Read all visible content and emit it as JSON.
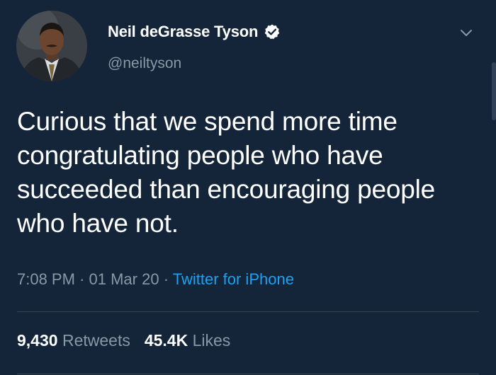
{
  "author": {
    "display_name": "Neil deGrasse Tyson",
    "handle": "@neiltyson",
    "verified": true
  },
  "tweet": {
    "text": "Curious that we spend more time congratulating people who have succeeded than encouraging people who have not.",
    "time": "7:08 PM",
    "separator": "·",
    "date": "01 Mar 20",
    "source": "Twitter for iPhone"
  },
  "stats": {
    "retweets_count": "9,430",
    "retweets_label": "Retweets",
    "likes_count": "45.4K",
    "likes_label": "Likes"
  },
  "icons": {
    "verified": "verified-badge-icon",
    "menu": "chevron-down-icon"
  },
  "colors": {
    "background": "#14253a",
    "primary_text": "#ffffff",
    "secondary_text": "#8899a6",
    "link": "#1da1f2",
    "divider": "#38444d"
  }
}
